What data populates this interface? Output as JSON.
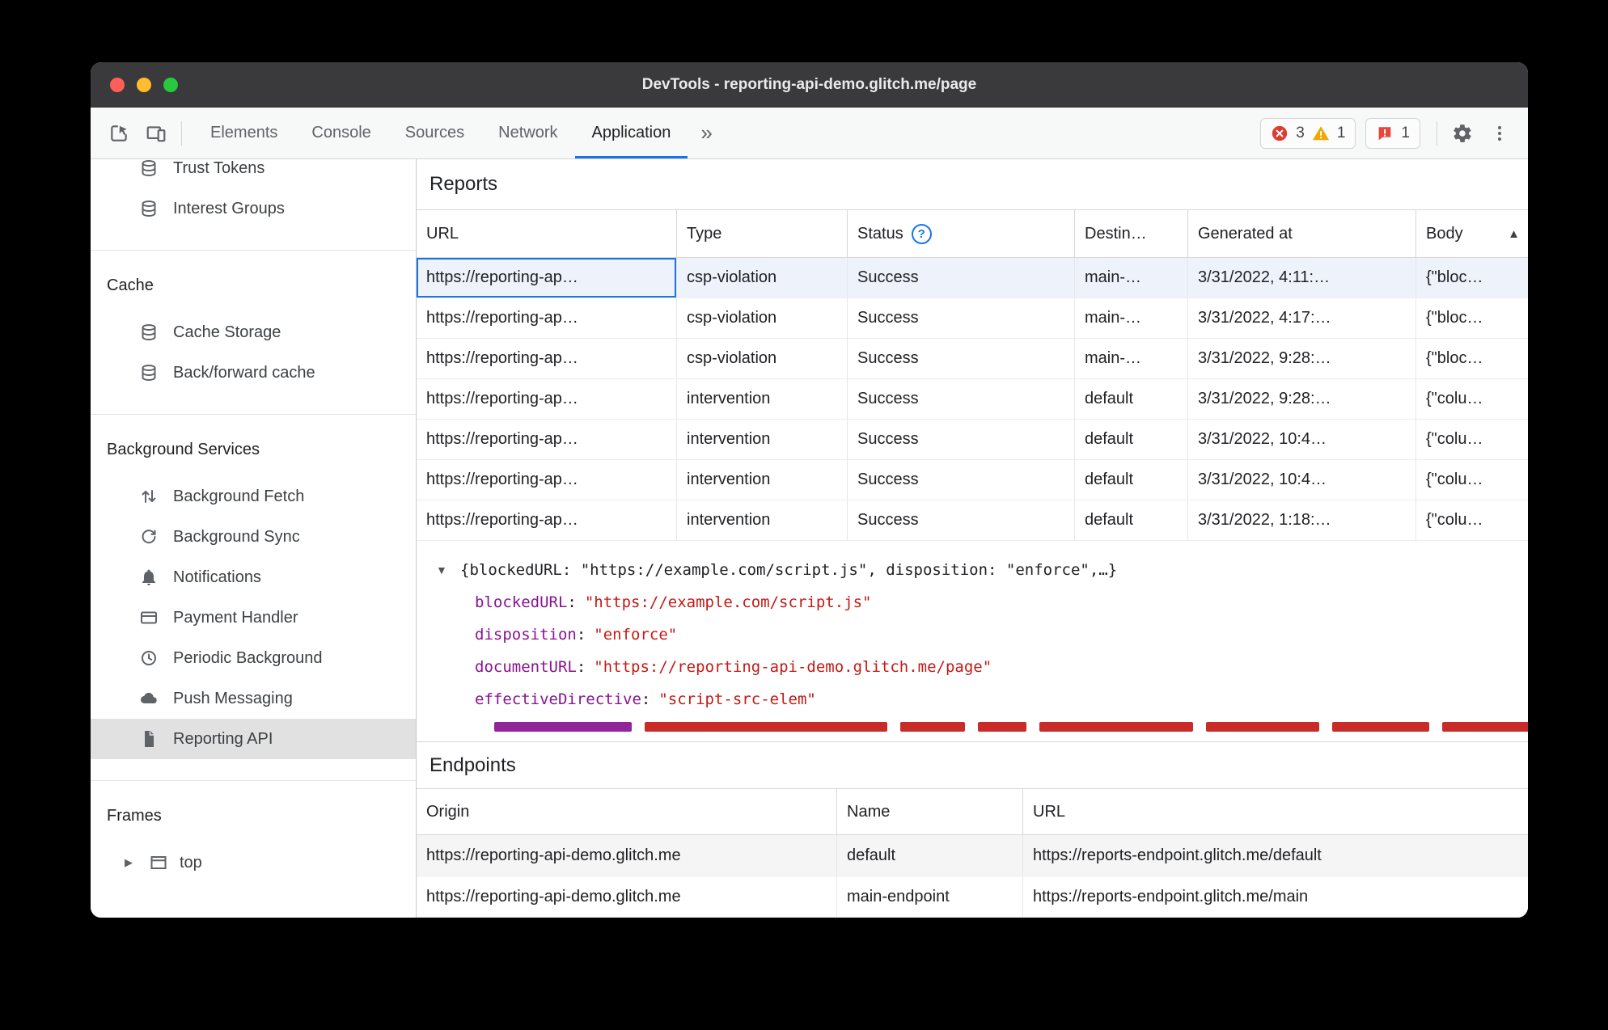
{
  "window_title": "DevTools - reporting-api-demo.glitch.me/page",
  "toolbar": {
    "tabs": [
      {
        "label": "Elements"
      },
      {
        "label": "Console"
      },
      {
        "label": "Sources"
      },
      {
        "label": "Network"
      },
      {
        "label": "Application"
      }
    ],
    "active_tab": "Application",
    "badges": {
      "errors": "3",
      "warnings": "1",
      "issues": "1"
    }
  },
  "sidebar": {
    "top_items": [
      {
        "label": "Trust Tokens"
      },
      {
        "label": "Interest Groups"
      }
    ],
    "sections": [
      {
        "header": "Cache",
        "items": [
          {
            "label": "Cache Storage"
          },
          {
            "label": "Back/forward cache"
          }
        ]
      },
      {
        "header": "Background Services",
        "items": [
          {
            "label": "Background Fetch"
          },
          {
            "label": "Background Sync"
          },
          {
            "label": "Notifications"
          },
          {
            "label": "Payment Handler"
          },
          {
            "label": "Periodic Background"
          },
          {
            "label": "Push Messaging"
          },
          {
            "label": "Reporting API"
          }
        ]
      },
      {
        "header": "Frames",
        "items": [
          {
            "label": "top"
          }
        ]
      }
    ],
    "selected_item": "Reporting API"
  },
  "reports": {
    "title": "Reports",
    "columns": {
      "url": "URL",
      "type": "Type",
      "status": "Status",
      "destination": "Destin…",
      "generated": "Generated at",
      "body": "Body"
    },
    "rows": [
      {
        "url": "https://reporting-ap…",
        "type": "csp-violation",
        "status": "Success",
        "destination": "main-…",
        "generated": "3/31/2022, 4:11:…",
        "body": "{\"bloc…"
      },
      {
        "url": "https://reporting-ap…",
        "type": "csp-violation",
        "status": "Success",
        "destination": "main-…",
        "generated": "3/31/2022, 4:17:…",
        "body": "{\"bloc…"
      },
      {
        "url": "https://reporting-ap…",
        "type": "csp-violation",
        "status": "Success",
        "destination": "main-…",
        "generated": "3/31/2022, 9:28:…",
        "body": "{\"bloc…"
      },
      {
        "url": "https://reporting-ap…",
        "type": "intervention",
        "status": "Success",
        "destination": "default",
        "generated": "3/31/2022, 9:28:…",
        "body": "{\"colu…"
      },
      {
        "url": "https://reporting-ap…",
        "type": "intervention",
        "status": "Success",
        "destination": "default",
        "generated": "3/31/2022, 10:4…",
        "body": "{\"colu…"
      },
      {
        "url": "https://reporting-ap…",
        "type": "intervention",
        "status": "Success",
        "destination": "default",
        "generated": "3/31/2022, 10:4…",
        "body": "{\"colu…"
      },
      {
        "url": "https://reporting-ap…",
        "type": "intervention",
        "status": "Success",
        "destination": "default",
        "generated": "3/31/2022, 1:18:…",
        "body": "{\"colu…"
      }
    ]
  },
  "preview": {
    "summary": "{blockedURL: \"https://example.com/script.js\", disposition: \"enforce\",…}",
    "properties": [
      {
        "key": "blockedURL",
        "value": "\"https://example.com/script.js\""
      },
      {
        "key": "disposition",
        "value": "\"enforce\""
      },
      {
        "key": "documentURL",
        "value": "\"https://reporting-api-demo.glitch.me/page\""
      },
      {
        "key": "effectiveDirective",
        "value": "\"script-src-elem\""
      }
    ]
  },
  "endpoints": {
    "title": "Endpoints",
    "columns": {
      "origin": "Origin",
      "name": "Name",
      "url": "URL"
    },
    "rows": [
      {
        "origin": "https://reporting-api-demo.glitch.me",
        "name": "default",
        "url": "https://reports-endpoint.glitch.me/default"
      },
      {
        "origin": "https://reporting-api-demo.glitch.me",
        "name": "main-endpoint",
        "url": "https://reports-endpoint.glitch.me/main"
      }
    ]
  },
  "glyphs": {
    "more_tabs": "»",
    "disclosure_down": "▼",
    "frame_expand": "▶",
    "sort_asc": "▲",
    "help": "?"
  },
  "colors": {
    "accent": "#1a73e8",
    "error": "#df3a32",
    "warning": "#f2a600",
    "json_key": "#881391",
    "json_string": "#c41a16",
    "traffic_red": "#ff5f57",
    "traffic_yellow": "#febc2e",
    "traffic_green": "#28c840",
    "selected_sidebar": "#e1e1e1",
    "selected_row": "#eef3fb"
  }
}
